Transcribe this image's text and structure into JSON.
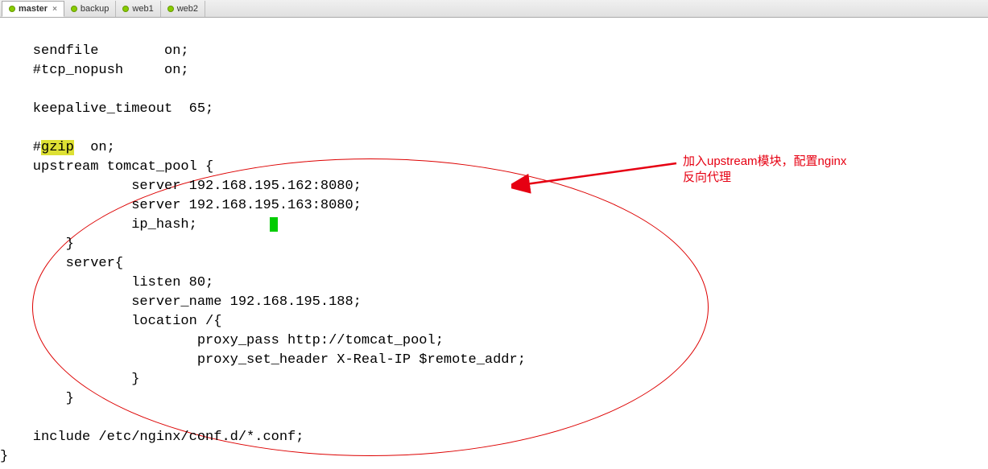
{
  "tabs": [
    {
      "label": "master",
      "active": true,
      "hasClose": true
    },
    {
      "label": "backup",
      "active": false,
      "hasClose": false
    },
    {
      "label": "web1",
      "active": false,
      "hasClose": false
    },
    {
      "label": "web2",
      "active": false,
      "hasClose": false
    }
  ],
  "code": {
    "line1_a": "    sendfile        on;",
    "line2": "    #tcp_nopush     on;",
    "line3": "",
    "line4": "    keepalive_timeout  65;",
    "line5": "",
    "line6_prefix": "    #",
    "line6_highlight": "gzip",
    "line6_suffix": "  on;",
    "line7": "    upstream tomcat_pool {",
    "line8": "                server 192.168.195.162:8080;",
    "line9": "                server 192.168.195.163:8080;",
    "line10": "                ip_hash;",
    "line11": "        }",
    "line12": "        server{",
    "line13": "                listen 80;",
    "line14": "                server_name 192.168.195.188;",
    "line15": "                location /{",
    "line16": "                        proxy_pass http://tomcat_pool;",
    "line17": "                        proxy_set_header X-Real-IP $remote_addr;",
    "line18": "                }",
    "line19": "        }",
    "line20": "",
    "line21": "    include /etc/nginx/conf.d/*.conf;",
    "line22": "}"
  },
  "annotation": {
    "text_line1": "加入upstream模块，配置nginx",
    "text_line2": "反向代理"
  },
  "close_symbol": "×"
}
